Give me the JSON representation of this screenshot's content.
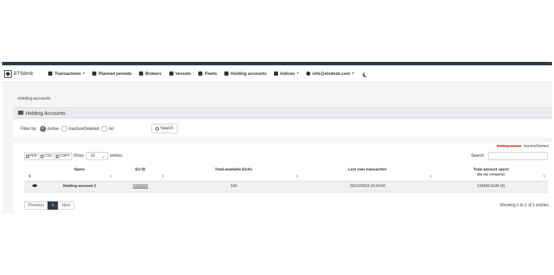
{
  "brand": {
    "name": "ETSdesk"
  },
  "nav": {
    "items": [
      {
        "label": "Transactions",
        "icon": "transactions-icon",
        "dropdown": true
      },
      {
        "label": "Planned periods",
        "icon": "calendar-icon",
        "dropdown": false
      },
      {
        "label": "Brokers",
        "icon": "broker-icon",
        "dropdown": false
      },
      {
        "label": "Vessels",
        "icon": "ship-icon",
        "dropdown": false
      },
      {
        "label": "Fleets",
        "icon": "fleet-icon",
        "dropdown": false
      },
      {
        "label": "Holding accounts",
        "icon": "account-icon",
        "dropdown": false
      },
      {
        "label": "Indices",
        "icon": "chart-icon",
        "dropdown": true
      },
      {
        "label": "info@etsdesk.com",
        "icon": "user-icon",
        "dropdown": true
      }
    ]
  },
  "breadcrumb": "Holding accounts",
  "panel": {
    "title": "Holding Accounts"
  },
  "filter": {
    "label": "Filter by:",
    "options": [
      {
        "label": "Active",
        "checked": true
      },
      {
        "label": "Inactive/Deleted",
        "checked": false
      },
      {
        "label": "All",
        "checked": false
      }
    ],
    "search_label": "Search"
  },
  "legend": {
    "struck": "Holding account",
    "text": "Inactive/Deleted"
  },
  "export": {
    "pdf": "PDF",
    "csv": "CSV",
    "copy": "COPY"
  },
  "length": {
    "show": "Show",
    "value": "10",
    "entries": "entries"
  },
  "search": {
    "label": "Search:",
    "value": ""
  },
  "table": {
    "headers": {
      "name": "Name",
      "eu_id": "EU ID",
      "euas": "Total available EUAs",
      "last_tx": "Last own transaction",
      "spent": "Total amount spent",
      "spent_sub": "(by my company)"
    },
    "rows": [
      {
        "name": "Holding account 1",
        "eu_id": "0000000",
        "euas": "150",
        "last_tx": "29/12/2023 15:24:50",
        "spent": "128960 EUR (€)"
      }
    ]
  },
  "pagination": {
    "previous": "Previous",
    "page": "1",
    "next": "Next",
    "info": "Showing 1 to 1 of 1 entries"
  },
  "colors": {
    "navbar_dark": "#2f3a49",
    "strike_red": "#c0392b"
  }
}
